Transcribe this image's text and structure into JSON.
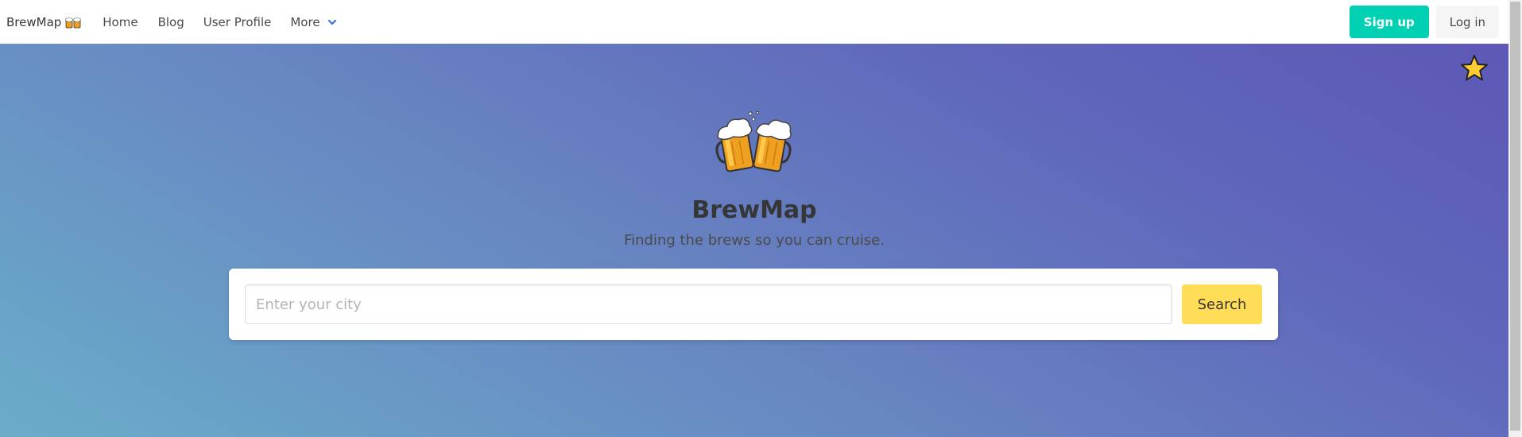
{
  "navbar": {
    "brand": "BrewMap",
    "brand_icon": "beer-mugs-icon",
    "links": {
      "home": "Home",
      "blog": "Blog",
      "profile": "User Profile",
      "more": "More"
    },
    "signup_label": "Sign up",
    "login_label": "Log in"
  },
  "hero": {
    "title": "BrewMap",
    "subtitle": "Finding the brews so you can cruise.",
    "logo_icon": "beer-mugs-icon",
    "favorite_icon": "star-icon"
  },
  "search": {
    "placeholder": "Enter your city",
    "value": "",
    "button_label": "Search"
  },
  "colors": {
    "signup": "#00d1b2",
    "search_button": "#ffdd57",
    "gradient_start": "#6aadc9",
    "gradient_end": "#5e58b6",
    "star": "#ffcc33"
  }
}
